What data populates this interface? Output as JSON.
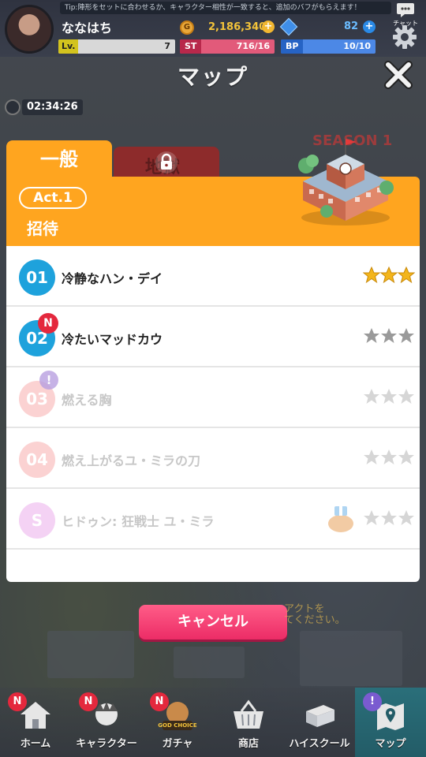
{
  "topbar": {
    "username": "ななはち",
    "tip_text": "Tip:陣形をセットに合わせるか、キャラクター相性が一致すると、追加のバフがもらえます！",
    "chat_label": "チャット",
    "gold": "2,186,340",
    "gold_coin_glyph": "G",
    "gems": "82",
    "level_label": "Lv.",
    "level": "7",
    "st_label": "ST",
    "st_value": "716/16",
    "bp_label": "BP",
    "bp_value": "10/10",
    "add_glyph": "+"
  },
  "page": {
    "title": "マップ",
    "timer": "02:34:26",
    "season_label": "SEASON 1"
  },
  "modal": {
    "tabs": {
      "general": "一般",
      "locked_faded": "地獄"
    },
    "act_label": "Act.1",
    "chapter_title": "招待",
    "stages": [
      {
        "num": "01",
        "name": "冷静なハン・デイ",
        "stars_earned": 3,
        "state": "active"
      },
      {
        "num": "02",
        "name": "冷たいマッドカウ",
        "stars_earned": 0,
        "state": "active",
        "badge": "N"
      },
      {
        "num": "03",
        "name": "燃える胸",
        "stars_earned": 0,
        "state": "locked",
        "badge": "!"
      },
      {
        "num": "04",
        "name": "燃え上がるユ・ミラの刀",
        "stars_earned": 0,
        "state": "locked"
      },
      {
        "num": "S",
        "name": "ヒドゥン: 狂戦士 ユ・ミラ",
        "stars_earned": 0,
        "state": "special"
      }
    ]
  },
  "cancel_label": "キャンセル",
  "faded_notice": [
    "アクトを",
    "てください。"
  ],
  "bottom_nav": [
    {
      "label": "ホーム",
      "badge": "N"
    },
    {
      "label": "キャラクター",
      "badge": "N"
    },
    {
      "label": "ガチャ",
      "badge": "N",
      "banner": "GOD CHOICE"
    },
    {
      "label": "商店"
    },
    {
      "label": "ハイスクール"
    },
    {
      "label": "マップ",
      "badge": "!",
      "selected": true
    }
  ],
  "colors": {
    "accent_orange": "#ffa51f",
    "locked_tab": "#8d2b2b",
    "stage_active": "#1ea2dc",
    "cancel_pink": "#ec2c66",
    "star_gold": "#f3b51b",
    "star_gray": "#9a9a9a"
  }
}
